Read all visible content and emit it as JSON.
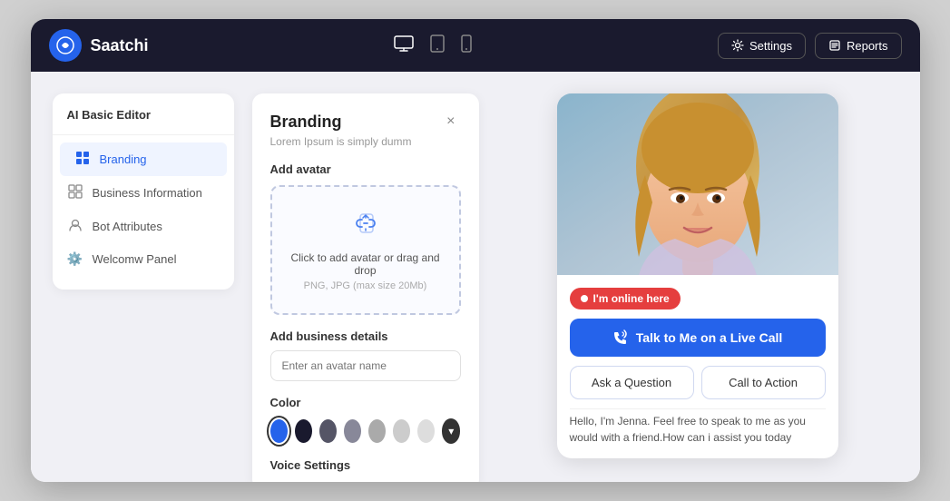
{
  "topbar": {
    "logo_text": "Saatchi",
    "settings_label": "Settings",
    "reports_label": "Reports",
    "devices": [
      "desktop",
      "tablet",
      "mobile"
    ]
  },
  "sidebar": {
    "title": "AI Basic Editor",
    "items": [
      {
        "id": "branding",
        "label": "Branding",
        "icon": "🟦",
        "active": true
      },
      {
        "id": "business",
        "label": "Business Information",
        "icon": "▦"
      },
      {
        "id": "bot",
        "label": "Bot Attributes",
        "icon": "👤"
      },
      {
        "id": "welcome",
        "label": "Welcomw Panel",
        "icon": "⚙️"
      }
    ]
  },
  "branding_panel": {
    "title": "Branding",
    "subtitle": "Lorem Ipsum is simply dumm",
    "close_label": "×",
    "add_avatar_label": "Add avatar",
    "upload_text": "Click to add avatar or drag and drop",
    "upload_hint": "PNG, JPG (max size 20Mb)",
    "business_details_label": "Add business details",
    "avatar_name_placeholder": "Enter an avatar name",
    "color_label": "Color",
    "colors": [
      {
        "hex": "#2563eb",
        "selected": true
      },
      {
        "hex": "#1a1a2e"
      },
      {
        "hex": "#555566"
      },
      {
        "hex": "#888899"
      },
      {
        "hex": "#aaaaaa"
      },
      {
        "hex": "#cccccc"
      },
      {
        "hex": "#dddddd"
      }
    ],
    "voice_label": "Voice Settings"
  },
  "widget": {
    "online_badge": "I'm online here",
    "live_call_btn": "Talk to Me on a Live Call",
    "ask_question_btn": "Ask a Question",
    "call_to_action_btn": "Call to Action",
    "chat_text": "Hello, I'm Jenna. Feel free to speak to me as you would with a friend.How can i assist you today"
  }
}
